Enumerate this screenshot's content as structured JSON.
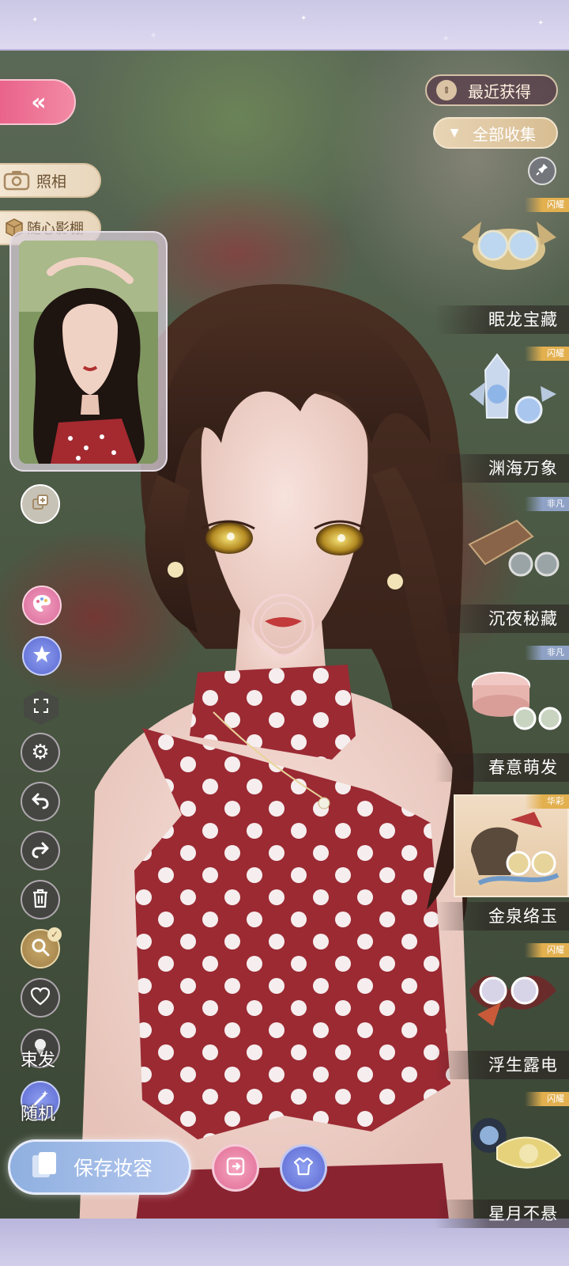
{
  "nav": {
    "back_icon": "double-chevron-left-icon",
    "photo_label": "照相",
    "studio_label": "随心影棚"
  },
  "sort": {
    "recent_label": "最近获得",
    "all_label": "全部收集"
  },
  "side_tools": {
    "tie_hair_label": "束发",
    "random_label": "随机"
  },
  "save": {
    "label": "保存妆容"
  },
  "items": [
    {
      "name": "眠龙宝藏",
      "tag": "闪耀",
      "tier": "gold"
    },
    {
      "name": "渊海万象",
      "tag": "闪耀",
      "tier": "gold"
    },
    {
      "name": "沉夜秘藏",
      "tag": "非凡",
      "tier": "silver"
    },
    {
      "name": "春意萌发",
      "tag": "非凡",
      "tier": "silver"
    },
    {
      "name": "金泉络玉",
      "tag": "华彩",
      "tier": "gold"
    },
    {
      "name": "浮生露电",
      "tag": "闪耀",
      "tier": "gold"
    },
    {
      "name": "星月不悬",
      "tag": "闪耀",
      "tier": "gold"
    }
  ],
  "colors": {
    "accent_pink": "#e9628a",
    "gold": "#d8bd92",
    "topbar": "#cbc8e6"
  }
}
